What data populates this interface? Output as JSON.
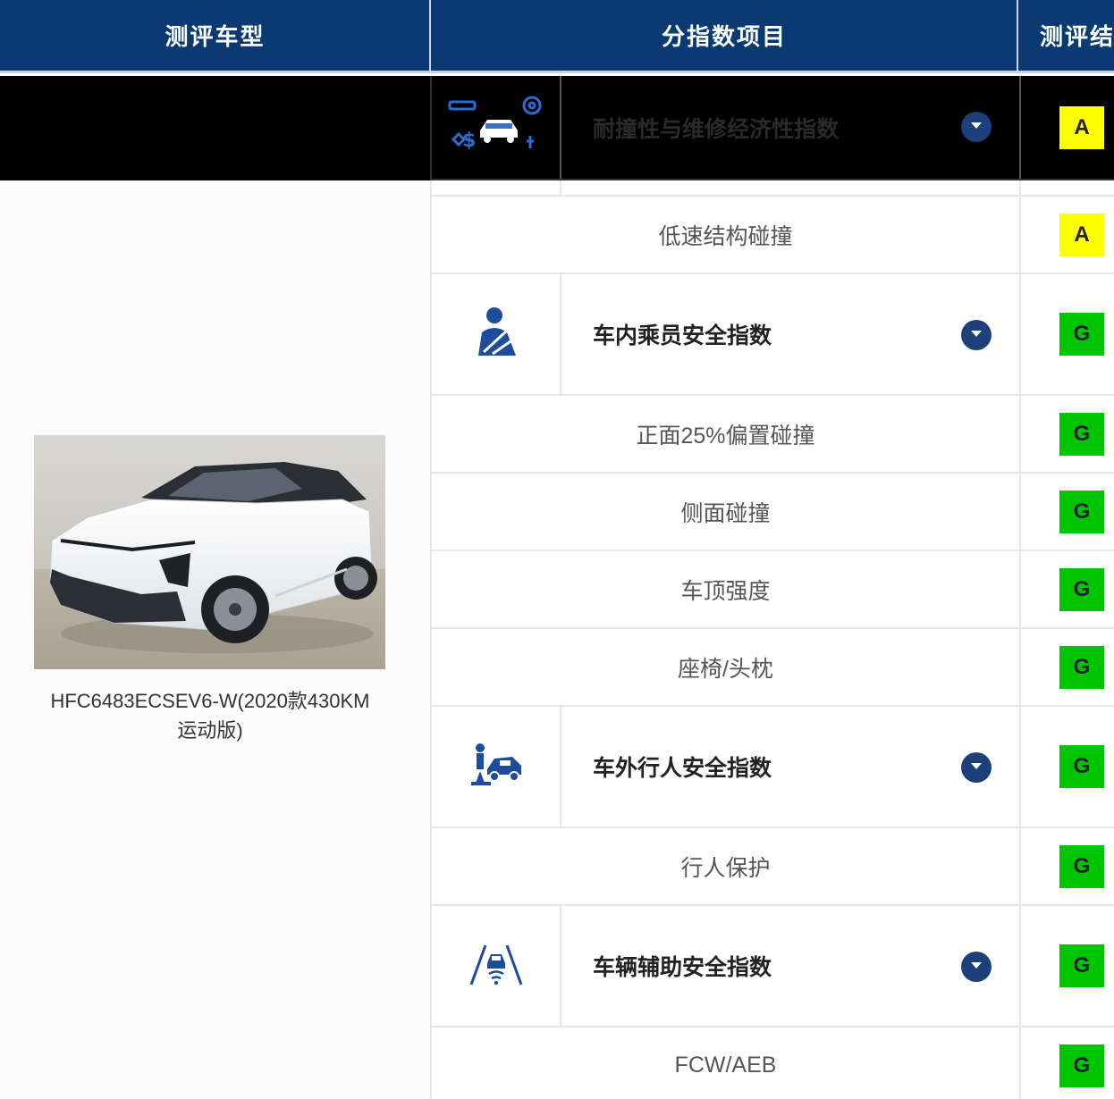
{
  "header": {
    "col_model": "测评车型",
    "col_items": "分指数项目",
    "col_result": "测评结果"
  },
  "vehicle": {
    "caption_line1": "HFC6483ECSEV6-W(2020款430KM",
    "caption_line2": "运动版)"
  },
  "rows": [
    {
      "type": "index",
      "label": "耐撞性与维修经济性指数",
      "result": "A",
      "icon": "repair-economy-icon"
    },
    {
      "type": "sub",
      "label": "低速结构碰撞",
      "result": "A"
    },
    {
      "type": "index",
      "label": "车内乘员安全指数",
      "result": "G",
      "icon": "seatbelt-occupant-icon"
    },
    {
      "type": "sub",
      "label": "正面25%偏置碰撞",
      "result": "G"
    },
    {
      "type": "sub",
      "label": "侧面碰撞",
      "result": "G"
    },
    {
      "type": "sub",
      "label": "车顶强度",
      "result": "G"
    },
    {
      "type": "sub",
      "label": "座椅/头枕",
      "result": "G"
    },
    {
      "type": "index",
      "label": "车外行人安全指数",
      "result": "G",
      "icon": "pedestrian-car-icon"
    },
    {
      "type": "sub",
      "label": "行人保护",
      "result": "G"
    },
    {
      "type": "index",
      "label": "车辆辅助安全指数",
      "result": "G",
      "icon": "lane-assist-icon"
    },
    {
      "type": "sub",
      "label": "FCW/AEB",
      "result": "G"
    }
  ],
  "colors": {
    "header_bg": "#0b3a72",
    "rating_A": "#ffff00",
    "rating_G": "#00c400",
    "expand_button": "#1d3f7a"
  }
}
